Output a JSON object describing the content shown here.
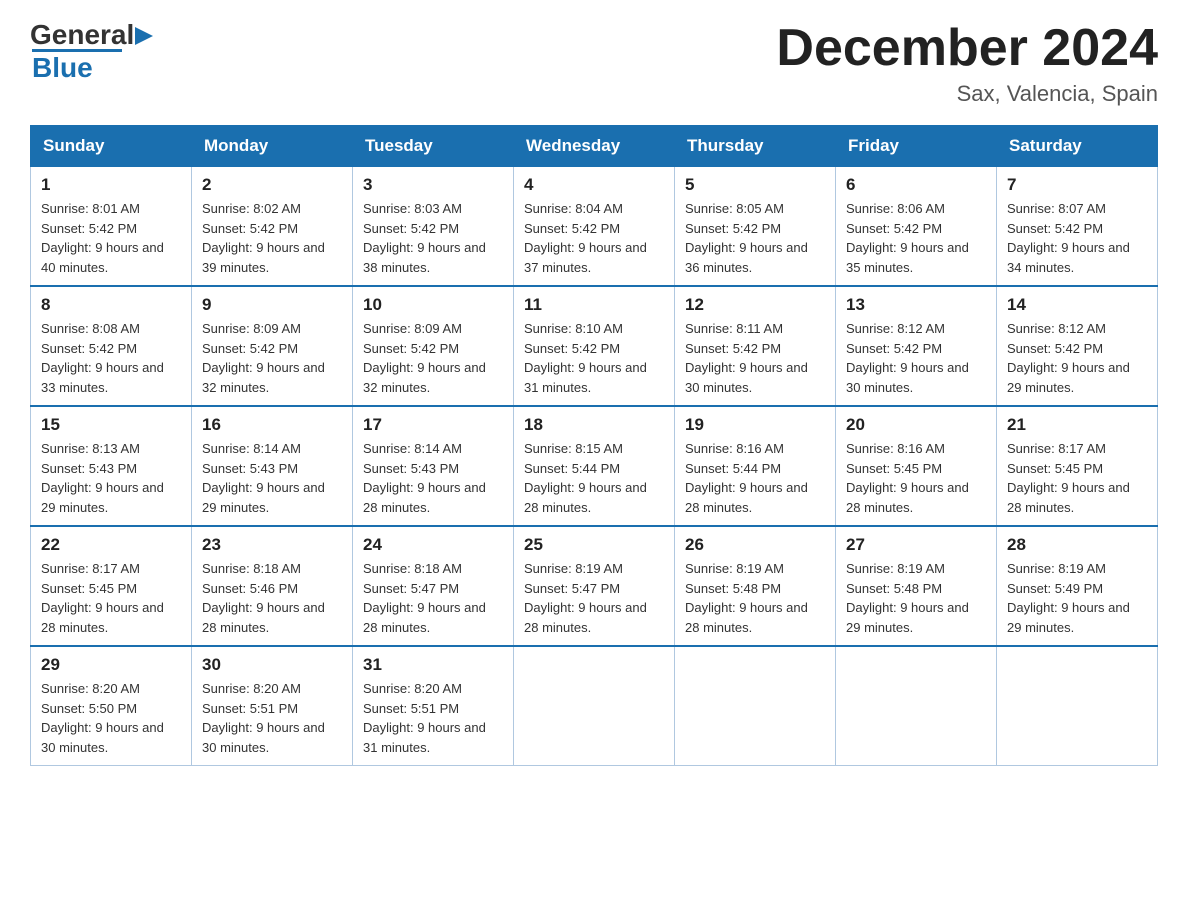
{
  "logo": {
    "general": "General",
    "blue": "Blue",
    "triangle": "▶"
  },
  "header": {
    "month_title": "December 2024",
    "subtitle": "Sax, Valencia, Spain"
  },
  "weekdays": [
    "Sunday",
    "Monday",
    "Tuesday",
    "Wednesday",
    "Thursday",
    "Friday",
    "Saturday"
  ],
  "weeks": [
    [
      {
        "day": "1",
        "sunrise": "8:01 AM",
        "sunset": "5:42 PM",
        "daylight": "9 hours and 40 minutes."
      },
      {
        "day": "2",
        "sunrise": "8:02 AM",
        "sunset": "5:42 PM",
        "daylight": "9 hours and 39 minutes."
      },
      {
        "day": "3",
        "sunrise": "8:03 AM",
        "sunset": "5:42 PM",
        "daylight": "9 hours and 38 minutes."
      },
      {
        "day": "4",
        "sunrise": "8:04 AM",
        "sunset": "5:42 PM",
        "daylight": "9 hours and 37 minutes."
      },
      {
        "day": "5",
        "sunrise": "8:05 AM",
        "sunset": "5:42 PM",
        "daylight": "9 hours and 36 minutes."
      },
      {
        "day": "6",
        "sunrise": "8:06 AM",
        "sunset": "5:42 PM",
        "daylight": "9 hours and 35 minutes."
      },
      {
        "day": "7",
        "sunrise": "8:07 AM",
        "sunset": "5:42 PM",
        "daylight": "9 hours and 34 minutes."
      }
    ],
    [
      {
        "day": "8",
        "sunrise": "8:08 AM",
        "sunset": "5:42 PM",
        "daylight": "9 hours and 33 minutes."
      },
      {
        "day": "9",
        "sunrise": "8:09 AM",
        "sunset": "5:42 PM",
        "daylight": "9 hours and 32 minutes."
      },
      {
        "day": "10",
        "sunrise": "8:09 AM",
        "sunset": "5:42 PM",
        "daylight": "9 hours and 32 minutes."
      },
      {
        "day": "11",
        "sunrise": "8:10 AM",
        "sunset": "5:42 PM",
        "daylight": "9 hours and 31 minutes."
      },
      {
        "day": "12",
        "sunrise": "8:11 AM",
        "sunset": "5:42 PM",
        "daylight": "9 hours and 30 minutes."
      },
      {
        "day": "13",
        "sunrise": "8:12 AM",
        "sunset": "5:42 PM",
        "daylight": "9 hours and 30 minutes."
      },
      {
        "day": "14",
        "sunrise": "8:12 AM",
        "sunset": "5:42 PM",
        "daylight": "9 hours and 29 minutes."
      }
    ],
    [
      {
        "day": "15",
        "sunrise": "8:13 AM",
        "sunset": "5:43 PM",
        "daylight": "9 hours and 29 minutes."
      },
      {
        "day": "16",
        "sunrise": "8:14 AM",
        "sunset": "5:43 PM",
        "daylight": "9 hours and 29 minutes."
      },
      {
        "day": "17",
        "sunrise": "8:14 AM",
        "sunset": "5:43 PM",
        "daylight": "9 hours and 28 minutes."
      },
      {
        "day": "18",
        "sunrise": "8:15 AM",
        "sunset": "5:44 PM",
        "daylight": "9 hours and 28 minutes."
      },
      {
        "day": "19",
        "sunrise": "8:16 AM",
        "sunset": "5:44 PM",
        "daylight": "9 hours and 28 minutes."
      },
      {
        "day": "20",
        "sunrise": "8:16 AM",
        "sunset": "5:45 PM",
        "daylight": "9 hours and 28 minutes."
      },
      {
        "day": "21",
        "sunrise": "8:17 AM",
        "sunset": "5:45 PM",
        "daylight": "9 hours and 28 minutes."
      }
    ],
    [
      {
        "day": "22",
        "sunrise": "8:17 AM",
        "sunset": "5:45 PM",
        "daylight": "9 hours and 28 minutes."
      },
      {
        "day": "23",
        "sunrise": "8:18 AM",
        "sunset": "5:46 PM",
        "daylight": "9 hours and 28 minutes."
      },
      {
        "day": "24",
        "sunrise": "8:18 AM",
        "sunset": "5:47 PM",
        "daylight": "9 hours and 28 minutes."
      },
      {
        "day": "25",
        "sunrise": "8:19 AM",
        "sunset": "5:47 PM",
        "daylight": "9 hours and 28 minutes."
      },
      {
        "day": "26",
        "sunrise": "8:19 AM",
        "sunset": "5:48 PM",
        "daylight": "9 hours and 28 minutes."
      },
      {
        "day": "27",
        "sunrise": "8:19 AM",
        "sunset": "5:48 PM",
        "daylight": "9 hours and 29 minutes."
      },
      {
        "day": "28",
        "sunrise": "8:19 AM",
        "sunset": "5:49 PM",
        "daylight": "9 hours and 29 minutes."
      }
    ],
    [
      {
        "day": "29",
        "sunrise": "8:20 AM",
        "sunset": "5:50 PM",
        "daylight": "9 hours and 30 minutes."
      },
      {
        "day": "30",
        "sunrise": "8:20 AM",
        "sunset": "5:51 PM",
        "daylight": "9 hours and 30 minutes."
      },
      {
        "day": "31",
        "sunrise": "8:20 AM",
        "sunset": "5:51 PM",
        "daylight": "9 hours and 31 minutes."
      },
      null,
      null,
      null,
      null
    ]
  ]
}
